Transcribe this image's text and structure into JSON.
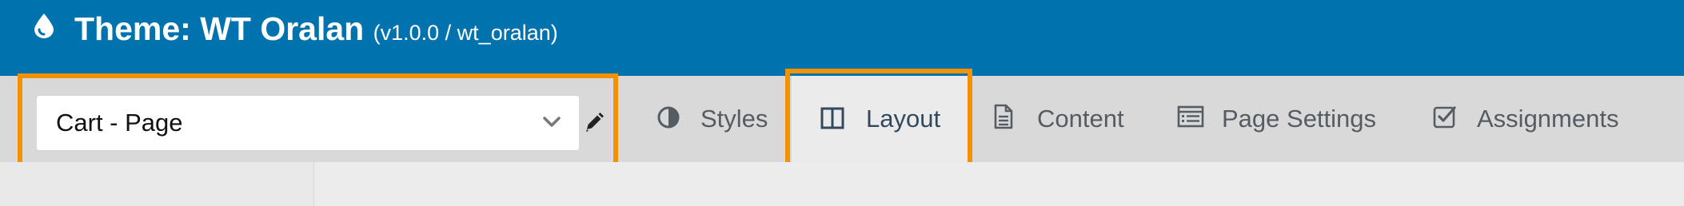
{
  "header": {
    "title": "Theme: WT Oralan",
    "subtitle": "(v1.0.0 / wt_oralan)",
    "icon": "drop-icon",
    "background": "#0072ad"
  },
  "outline_highlight_color": "#f39200",
  "page_selector": {
    "value": "Cart - Page",
    "icon": "chevron-down-icon",
    "edit_icon": "pencil-icon"
  },
  "tabs": [
    {
      "label": "Styles",
      "icon": "half-circle-icon",
      "active": false
    },
    {
      "label": "Layout",
      "icon": "columns-icon",
      "active": true
    },
    {
      "label": "Content",
      "icon": "document-icon",
      "active": false
    },
    {
      "label": "Page Settings",
      "icon": "list-panel-icon",
      "active": false
    },
    {
      "label": "Assignments",
      "icon": "checkbox-icon",
      "active": false
    }
  ]
}
